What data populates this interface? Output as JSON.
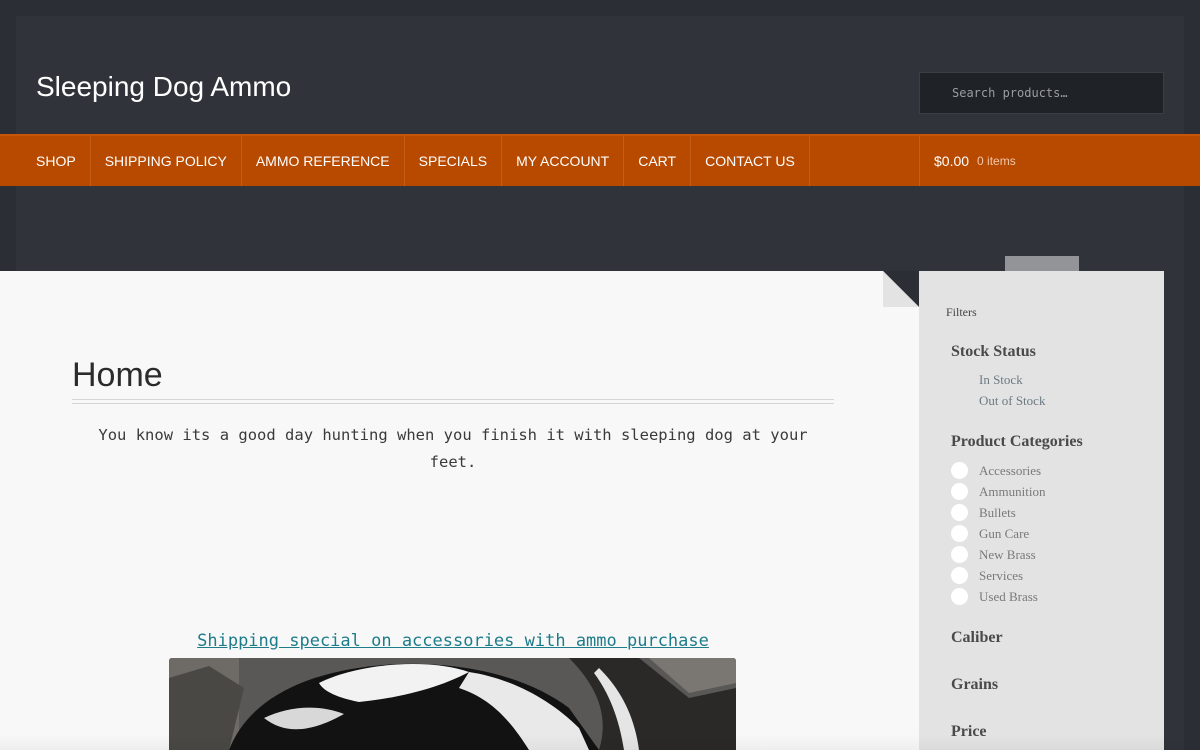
{
  "header": {
    "site_title": "Sleeping Dog Ammo",
    "search_placeholder": "Search products…"
  },
  "nav": {
    "items": [
      "SHOP",
      "SHIPPING POLICY",
      "AMMO REFERENCE",
      "SPECIALS",
      "MY ACCOUNT",
      "CART",
      "CONTACT US"
    ],
    "cart_total": "$0.00",
    "cart_count": "0 items"
  },
  "main": {
    "heading": "Home",
    "intro": "You know its a good day hunting when you finish it with sleeping dog at your feet.",
    "promo_link": "Shipping special on accessories with ammo purchase"
  },
  "sidebar": {
    "filters_label": "Filters",
    "stock_status": {
      "title": "Stock Status",
      "options": [
        "In Stock",
        "Out of Stock"
      ]
    },
    "product_categories": {
      "title": "Product Categories",
      "options": [
        "Accessories",
        "Ammunition",
        "Bullets",
        "Gun Care",
        "New Brass",
        "Services",
        "Used Brass"
      ]
    },
    "caliber_title": "Caliber",
    "grains_title": "Grains",
    "price_title": "Price"
  },
  "colors": {
    "nav_bg": "#b84a00",
    "page_bg": "#2b2f35",
    "link": "#1d7c8a"
  }
}
